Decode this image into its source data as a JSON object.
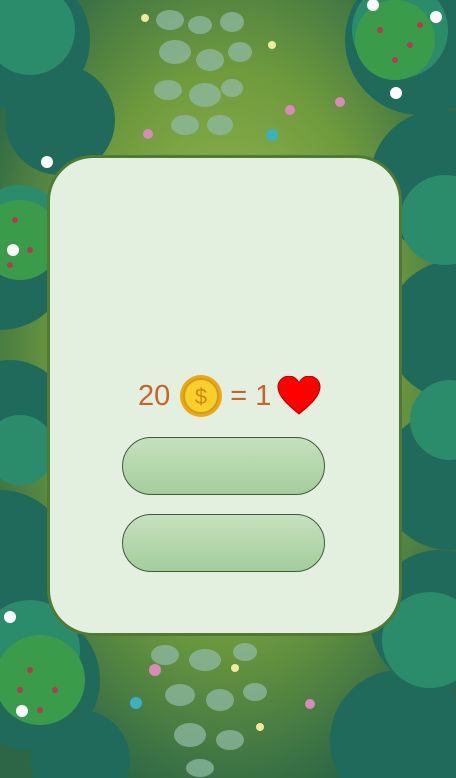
{
  "exchange": {
    "coin_amount": "20",
    "equals": "=",
    "heart_amount": "1",
    "coin_symbol": "$",
    "coin_icon": "gold-coin",
    "heart_icon": "red-heart"
  },
  "buttons": [
    {
      "label": ""
    },
    {
      "label": ""
    }
  ],
  "colors": {
    "panel_bg": "#e3efdf",
    "panel_border": "#4f7a34",
    "text": "#c8632a",
    "button_fill": "#b5d7ad",
    "heart": "#ff0000",
    "coin": "#f5c518"
  }
}
